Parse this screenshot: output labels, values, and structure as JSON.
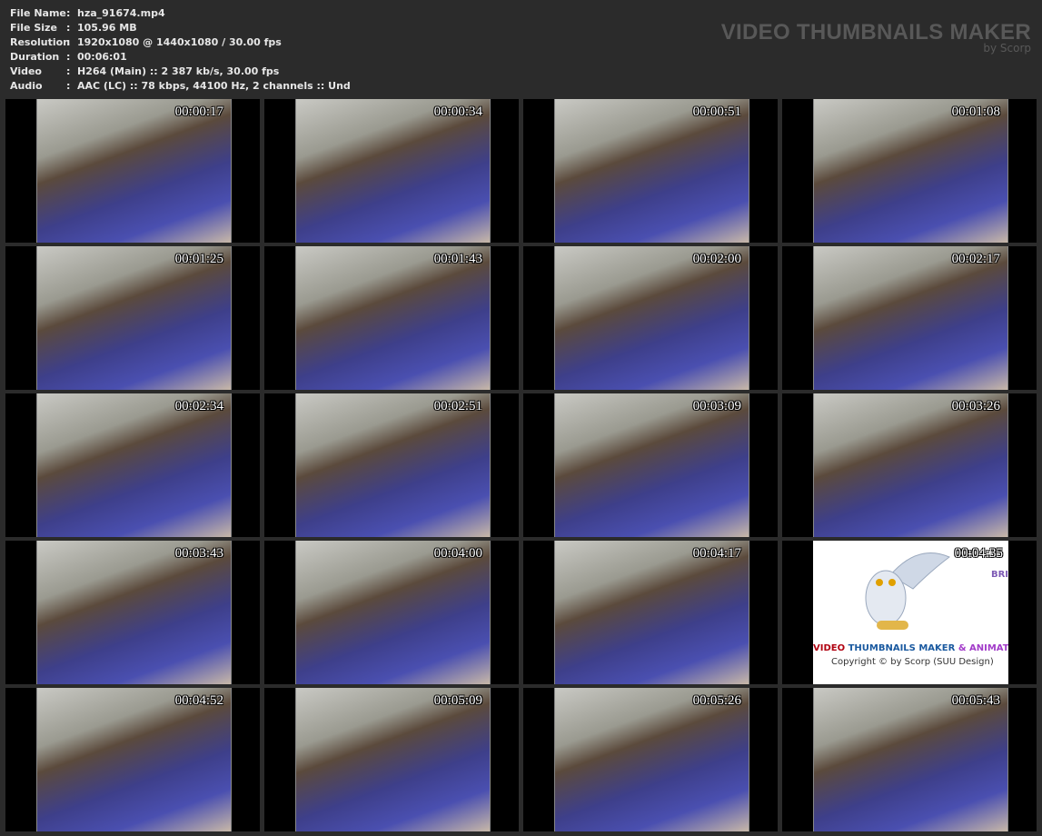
{
  "info": [
    {
      "key": "File Name",
      "value": "hza_91674.mp4"
    },
    {
      "key": "File Size",
      "value": "105.96 MB"
    },
    {
      "key": "Resolution",
      "value": "1920x1080 @ 1440x1080 / 30.00 fps"
    },
    {
      "key": "Duration",
      "value": "00:06:01"
    },
    {
      "key": "Video",
      "value": "H264 (Main) :: 2 387 kb/s, 30.00 fps"
    },
    {
      "key": "Audio",
      "value": "AAC (LC) :: 78 kbps, 44100 Hz, 2 channels :: Und"
    }
  ],
  "brand": {
    "title": "VIDEO THUMBNAILS MAKER",
    "subtitle": "by Scorp"
  },
  "thumbnails": [
    "00:00:17",
    "00:00:34",
    "00:00:51",
    "00:01:08",
    "00:01:25",
    "00:01:43",
    "00:02:00",
    "00:02:17",
    "00:02:34",
    "00:02:51",
    "00:03:09",
    "00:03:26",
    "00:03:43",
    "00:04:00",
    "00:04:17",
    "00:04:35",
    "00:04:52",
    "00:05:09",
    "00:05:26",
    "00:05:43"
  ],
  "promo": {
    "index": 15,
    "bri": "BRI",
    "title_a": "VIDEO ",
    "title_b": "THUMBNAILS MAKER ",
    "title_c": "& ANIMATOR",
    "copyright": "Copyright © by Scorp (SUU Design)"
  }
}
